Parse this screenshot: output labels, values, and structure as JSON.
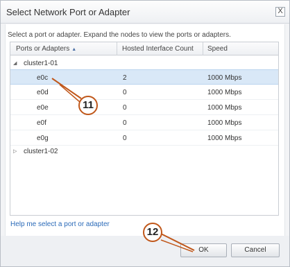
{
  "dialog": {
    "title": "Select Network Port or Adapter",
    "close_symbol": "X",
    "instructions": "Select a port or adapter. Expand the nodes to view the ports or adapters."
  },
  "grid": {
    "columns": [
      "Ports or Adapters",
      "Hosted Interface Count",
      "Speed"
    ],
    "sort_icon": "▲",
    "expanded_icon": "◢",
    "collapsed_icon": "▷",
    "cluster1": {
      "name": "cluster1-01",
      "rows": [
        {
          "port": "e0c",
          "count": "2",
          "speed": "1000 Mbps",
          "selected": true
        },
        {
          "port": "e0d",
          "count": "0",
          "speed": "1000 Mbps"
        },
        {
          "port": "e0e",
          "count": "0",
          "speed": "1000 Mbps"
        },
        {
          "port": "e0f",
          "count": "0",
          "speed": "1000 Mbps"
        },
        {
          "port": "e0g",
          "count": "0",
          "speed": "1000 Mbps"
        }
      ]
    },
    "cluster2": {
      "name": "cluster1-02"
    }
  },
  "help_link": "Help me select a port or adapter",
  "buttons": {
    "ok": "OK",
    "cancel": "Cancel"
  },
  "callouts": {
    "c11": "11",
    "c12": "12",
    "color": "#c0571a"
  }
}
